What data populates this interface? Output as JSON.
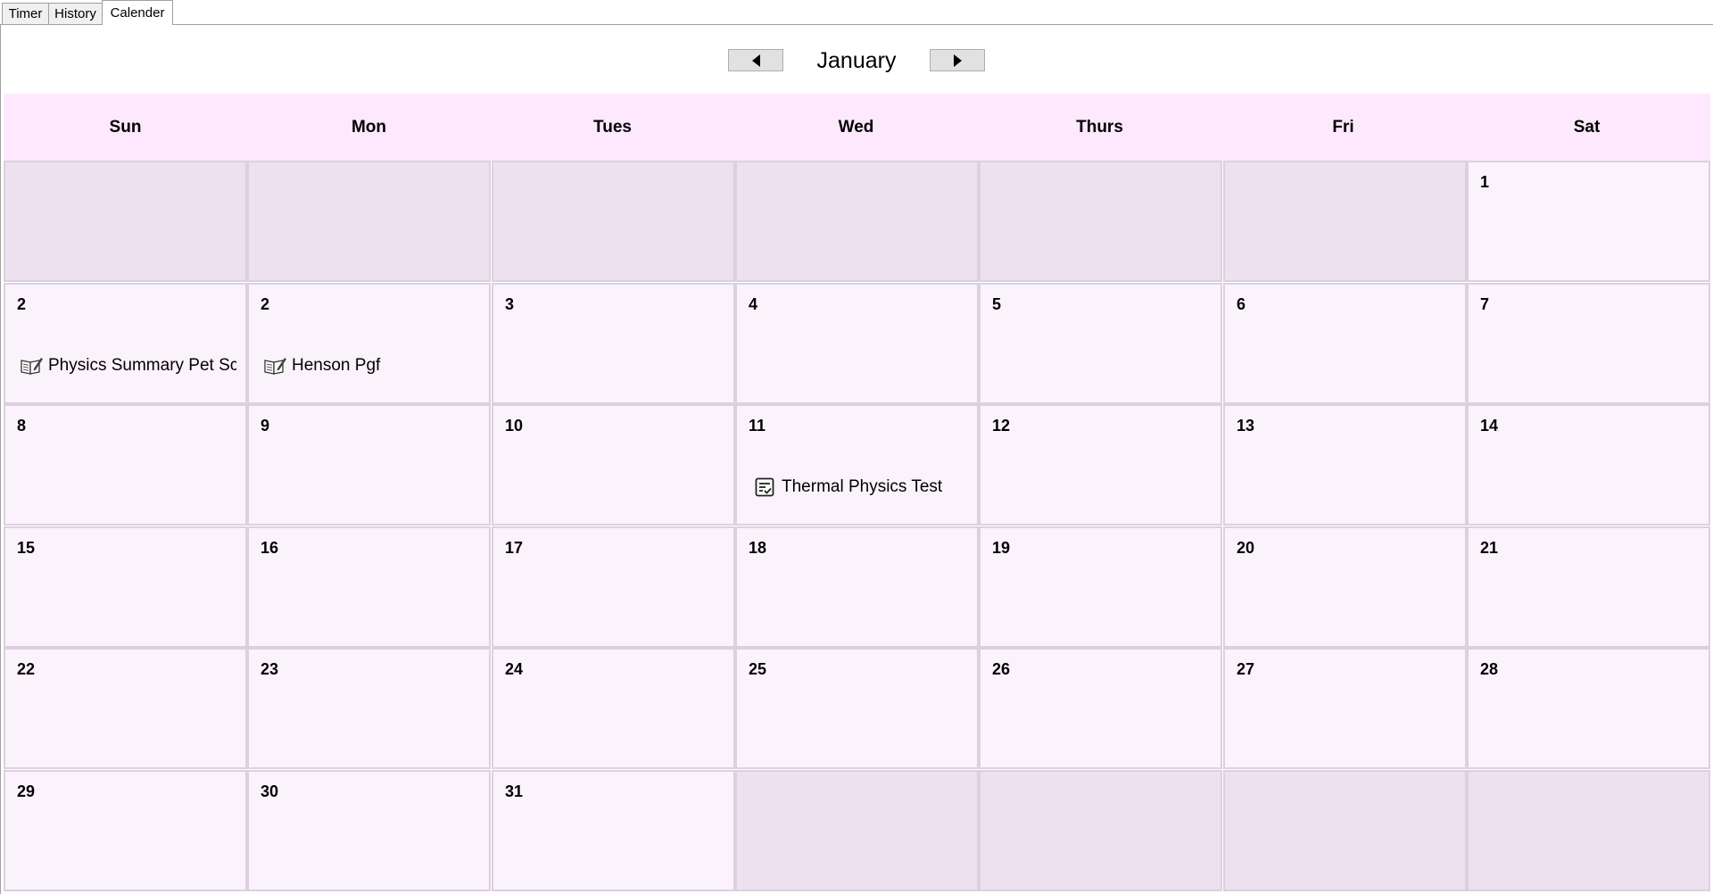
{
  "tabs": [
    {
      "label": "Timer",
      "active": false
    },
    {
      "label": "History",
      "active": false
    },
    {
      "label": "Calender",
      "active": true
    }
  ],
  "nav": {
    "month": "January",
    "prev_icon": "triangle-left-icon",
    "next_icon": "triangle-right-icon"
  },
  "weekdays": [
    "Sun",
    "Mon",
    "Tues",
    "Wed",
    "Thurs",
    "Fri",
    "Sat"
  ],
  "weeks": [
    [
      {
        "day": ""
      },
      {
        "day": ""
      },
      {
        "day": ""
      },
      {
        "day": ""
      },
      {
        "day": ""
      },
      {
        "day": ""
      },
      {
        "day": "1"
      }
    ],
    [
      {
        "day": "2",
        "event": {
          "label": "Physics Summary Pet Sc",
          "icon": "book-pencil-icon"
        }
      },
      {
        "day": "2",
        "event": {
          "label": "Henson Pgf",
          "icon": "book-pencil-icon"
        }
      },
      {
        "day": "3"
      },
      {
        "day": "4"
      },
      {
        "day": "5"
      },
      {
        "day": "6"
      },
      {
        "day": "7"
      }
    ],
    [
      {
        "day": "8"
      },
      {
        "day": "9"
      },
      {
        "day": "10"
      },
      {
        "day": "11",
        "event": {
          "label": "Thermal Physics Test",
          "icon": "checklist-icon"
        }
      },
      {
        "day": "12"
      },
      {
        "day": "13"
      },
      {
        "day": "14"
      }
    ],
    [
      {
        "day": "15"
      },
      {
        "day": "16"
      },
      {
        "day": "17"
      },
      {
        "day": "18"
      },
      {
        "day": "19"
      },
      {
        "day": "20"
      },
      {
        "day": "21"
      }
    ],
    [
      {
        "day": "22"
      },
      {
        "day": "23"
      },
      {
        "day": "24"
      },
      {
        "day": "25"
      },
      {
        "day": "26"
      },
      {
        "day": "27"
      },
      {
        "day": "28"
      }
    ],
    [
      {
        "day": "29"
      },
      {
        "day": "30"
      },
      {
        "day": "31"
      },
      {
        "day": ""
      },
      {
        "day": ""
      },
      {
        "day": ""
      },
      {
        "day": ""
      }
    ]
  ],
  "colors": {
    "header_band": "#fde8fd",
    "cell": "#fbf3fb",
    "empty_cell": "#ede0ef",
    "cell_border": "#dcd0e0"
  }
}
